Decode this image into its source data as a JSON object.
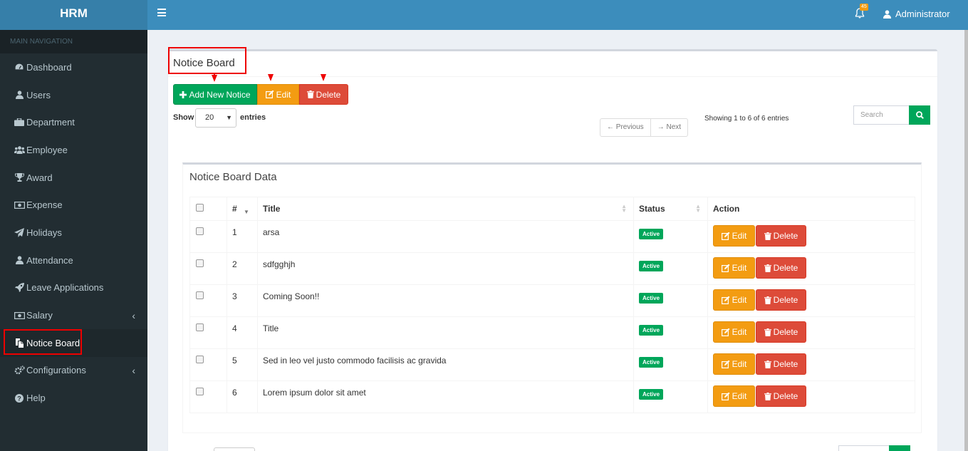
{
  "app": {
    "title": "HRM",
    "user": "Administrator",
    "notification_count": "45"
  },
  "sidebar": {
    "header": "MAIN NAVIGATION",
    "items": [
      {
        "label": "Dashboard",
        "icon": "dashboard-icon"
      },
      {
        "label": "Users",
        "icon": "user-icon"
      },
      {
        "label": "Department",
        "icon": "briefcase-icon"
      },
      {
        "label": "Employee",
        "icon": "users-icon"
      },
      {
        "label": "Award",
        "icon": "trophy-icon"
      },
      {
        "label": "Expense",
        "icon": "money-icon"
      },
      {
        "label": "Holidays",
        "icon": "paper-plane-icon"
      },
      {
        "label": "Attendance",
        "icon": "user-icon"
      },
      {
        "label": "Leave Applications",
        "icon": "rocket-icon"
      },
      {
        "label": "Salary",
        "icon": "money-icon"
      },
      {
        "label": "Notice Board",
        "icon": "files-icon"
      },
      {
        "label": "Configurations",
        "icon": "gears-icon"
      },
      {
        "label": "Help",
        "icon": "question-icon"
      }
    ]
  },
  "page": {
    "title": "Notice Board",
    "add_label": "Add New Notice",
    "edit_label": "Edit",
    "delete_label": "Delete"
  },
  "controls": {
    "show_label": "Show",
    "page_size": "20",
    "entries_label": "entries",
    "prev_label": "← Previous",
    "next_label": "→ Next",
    "showing": "Showing 1 to 6 of 6 entries",
    "search_placeholder": "Search"
  },
  "table": {
    "title": "Notice Board Data",
    "headers": {
      "num": "#",
      "title": "Title",
      "status": "Status",
      "action": "Action"
    },
    "rows": [
      {
        "num": "1",
        "title": "arsa",
        "status": "Active"
      },
      {
        "num": "2",
        "title": "sdfgghjh",
        "status": "Active"
      },
      {
        "num": "3",
        "title": "Coming Soon!!",
        "status": "Active"
      },
      {
        "num": "4",
        "title": "Title",
        "status": "Active"
      },
      {
        "num": "5",
        "title": "Sed in leo vel justo commodo facilisis ac gravida",
        "status": "Active"
      },
      {
        "num": "6",
        "title": "Lorem ipsum dolor sit amet",
        "status": "Active"
      }
    ],
    "row_edit_label": "Edit",
    "row_delete_label": "Delete"
  },
  "colors": {
    "header": "#3c8dbc",
    "logo": "#367fa9",
    "sidebar": "#222d32",
    "success": "#00a65a",
    "warning": "#f39c12",
    "danger": "#dd4b39",
    "highlight": "#ee0000"
  }
}
